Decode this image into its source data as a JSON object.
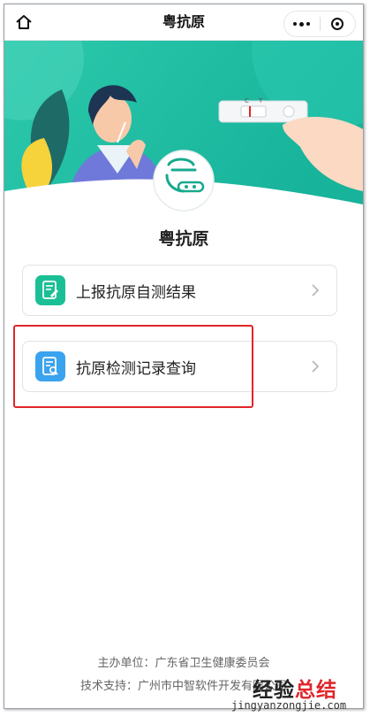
{
  "nav": {
    "title": "粤抗原",
    "home_icon": "home-icon",
    "more_icon": "more-dots-icon",
    "close_icon": "target-circle-icon"
  },
  "banner": {
    "test_strip_letters": [
      "C",
      "T"
    ],
    "logo_icon": "yue-logo-icon"
  },
  "app": {
    "title": "粤抗原"
  },
  "menu": [
    {
      "label": "上报抗原自测结果",
      "icon": "report-form-icon",
      "color": "#1bbf95"
    },
    {
      "label": "抗原检测记录查询",
      "icon": "record-search-icon",
      "color": "#3aa3ef"
    }
  ],
  "footer": {
    "organizer": "主办单位：广东省卫生健康委员会",
    "tech_support": "技术支持：广州市中智软件开发有限公司"
  },
  "watermark": {
    "chinese_black": "经验",
    "chinese_red": "总结",
    "url": "jingyanzongjie.com"
  },
  "colors": {
    "banner_teal": "#1fbfa6",
    "highlight_red": "#e0262b"
  }
}
